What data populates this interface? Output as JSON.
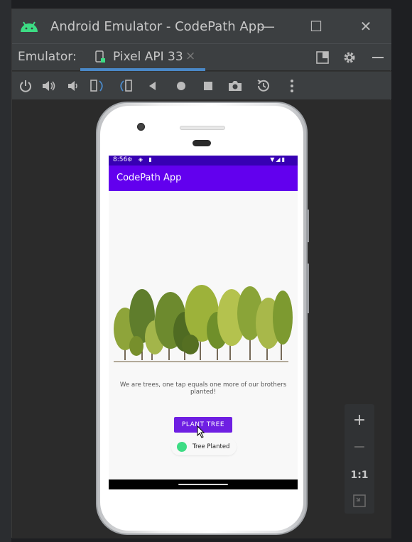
{
  "window": {
    "title": "Android Emulator - CodePath App",
    "minimize": "—",
    "maximize": "☐",
    "close": "✕"
  },
  "tabbar": {
    "label": "Emulator:",
    "device_tab": "Pixel API 33",
    "tab_close": "×"
  },
  "toolbar_icons": [
    "power-icon",
    "volume-up-icon",
    "volume-down-icon",
    "rotate-left-icon",
    "rotate-right-icon",
    "back-icon",
    "home-icon",
    "overview-icon",
    "screenshot-icon",
    "snapshot-icon",
    "more-icon"
  ],
  "device": {
    "status_time": "8:56",
    "app_title": "CodePath App",
    "caption": "We are trees, one tap equals one more of our brothers planted!",
    "button_label": "PLANT TREE",
    "toast_text": "Tree Planted"
  },
  "zoom": {
    "plus": "+",
    "minus": "−",
    "one_to_one": "1:1"
  },
  "colors": {
    "status_bar": "#3700b3",
    "app_bar": "#6200ee",
    "button": "#6e1fe2",
    "tab_underline": "#4a88c7"
  }
}
